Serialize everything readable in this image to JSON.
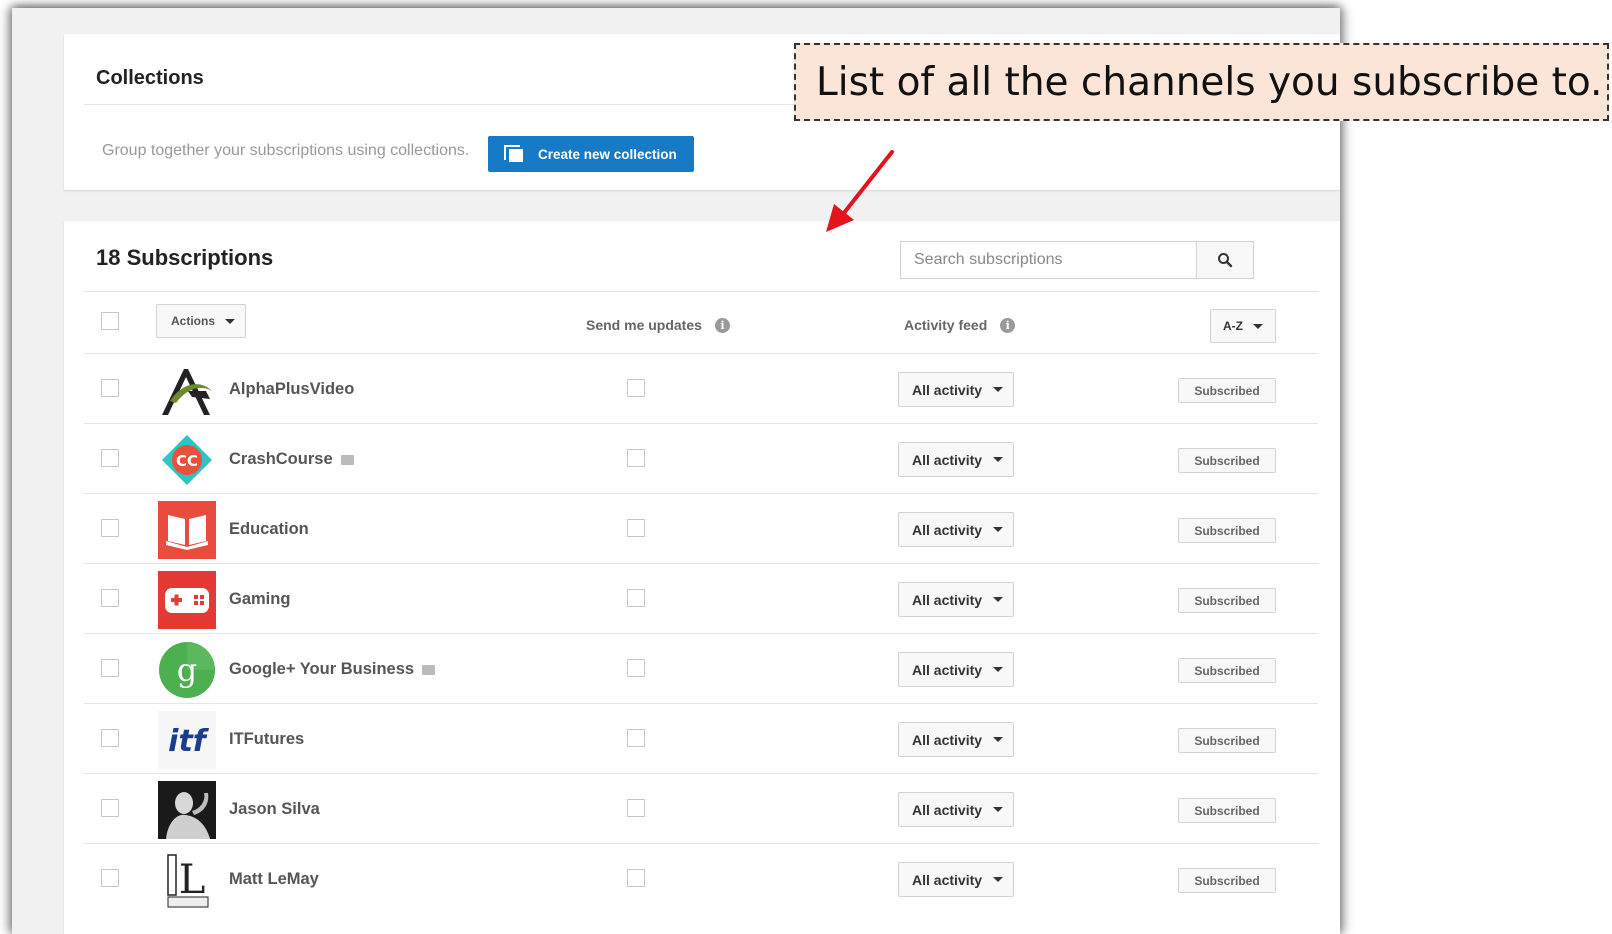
{
  "collections": {
    "title": "Collections",
    "description": "Group together your subscriptions using collections.",
    "create_button": "Create new collection"
  },
  "subscriptions": {
    "title": "18 Subscriptions",
    "search_placeholder": "Search subscriptions",
    "actions_label": "Actions",
    "send_updates_header": "Send me updates",
    "activity_feed_header": "Activity feed",
    "sort_label": "A-Z",
    "rows": [
      {
        "name": "AlphaPlusVideo",
        "verified": false,
        "avatar": "alphaplus-logo",
        "activity": "All activity",
        "status": "Subscribed"
      },
      {
        "name": "CrashCourse",
        "verified": true,
        "avatar": "crashcourse-logo",
        "avatar_text": "CC",
        "activity": "All activity",
        "status": "Subscribed"
      },
      {
        "name": "Education",
        "verified": false,
        "avatar": "book-icon",
        "activity": "All activity",
        "status": "Subscribed"
      },
      {
        "name": "Gaming",
        "verified": false,
        "avatar": "gamepad-icon",
        "activity": "All activity",
        "status": "Subscribed"
      },
      {
        "name": "Google+ Your Business",
        "verified": true,
        "avatar": "google-business-logo",
        "avatar_text": "g",
        "activity": "All activity",
        "status": "Subscribed"
      },
      {
        "name": "ITFutures",
        "verified": false,
        "avatar": "itf-logo",
        "avatar_text": "itf",
        "activity": "All activity",
        "status": "Subscribed"
      },
      {
        "name": "Jason Silva",
        "verified": false,
        "avatar": "profile-photo",
        "activity": "All activity",
        "status": "Subscribed"
      },
      {
        "name": "Matt LeMay",
        "verified": false,
        "avatar": "lemay-logo",
        "avatar_text": "L",
        "activity": "All activity",
        "status": "Subscribed"
      }
    ]
  },
  "annotation": {
    "text": "List of all the channels you subscribe to."
  },
  "colors": {
    "primary_blue": "#167ac6",
    "annotation_bg": "#fbe5d6",
    "arrow_red": "#e3141b",
    "education_red": "#e74c3c",
    "gaming_red": "#e53935",
    "google_green": "#4caf50",
    "crashcourse_teal": "#2ec4c4",
    "crashcourse_red": "#e8513b"
  }
}
